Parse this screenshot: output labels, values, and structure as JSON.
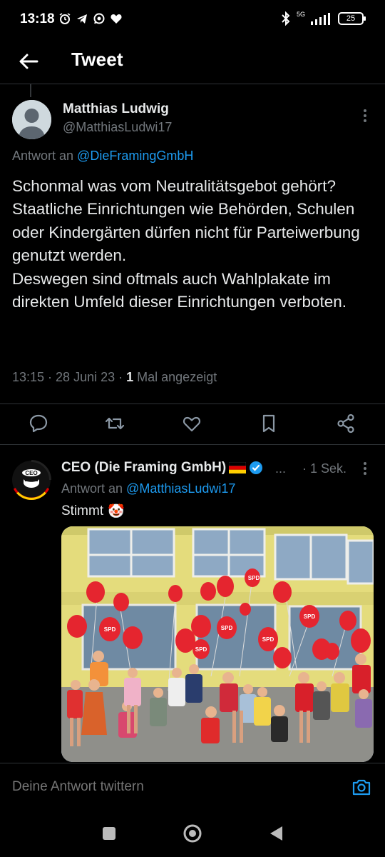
{
  "status_bar": {
    "time": "13:18",
    "network": "5G",
    "battery": "25"
  },
  "header": {
    "title": "Tweet"
  },
  "main_tweet": {
    "author_name": "Matthias Ludwig",
    "author_handle": "@MatthiasLudwi17",
    "reply_prefix": "Antwort an ",
    "reply_to": "@DieFramingGmbH",
    "text": "Schonmal was vom Neutralitätsgebot gehört? Staatliche Einrichtungen wie Behörden, Schulen oder Kindergärten dürfen nicht für Parteiwerbung genutzt werden.\nDeswegen sind oftmals auch Wahlplakate im direkten Umfeld dieser Einrichtungen verboten.",
    "time": "13:15",
    "date": "28 Juni 23",
    "views_count": "1",
    "views_label": " Mal angezeigt",
    "sep": " · "
  },
  "reply_tweet": {
    "author_name": "CEO (Die Framing GmbH)",
    "name_ellipsis": "...",
    "time": "· 1 Sek.",
    "reply_prefix": "Antwort an ",
    "reply_to": "@MatthiasLudwi17",
    "text": "Stimmt",
    "emoji": "🤡",
    "avatar_text": "CEO",
    "balloon_label": "SPD"
  },
  "compose": {
    "placeholder": "Deine Antwort twittern"
  },
  "icons": {
    "back": "arrow-left-icon",
    "reply": "speech-bubble-icon",
    "retweet": "retweet-icon",
    "like": "heart-icon",
    "bookmark": "bookmark-icon",
    "share": "share-icon",
    "camera": "camera-icon"
  },
  "colors": {
    "accent": "#1d9bf0",
    "background": "#000000",
    "muted_text": "#71767b",
    "primary_text": "#e7e9ea",
    "divider": "#2f3336"
  }
}
